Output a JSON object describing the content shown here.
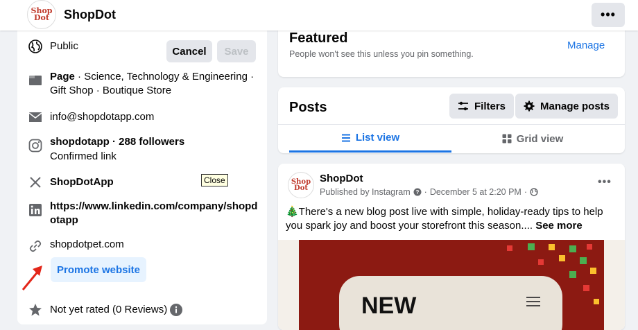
{
  "header": {
    "logo_text": "ShopDot",
    "page_name": "ShopDot",
    "more_label": "•••"
  },
  "intro": {
    "audience": "Public",
    "cancel_label": "Cancel",
    "save_label": "Save",
    "category_prefix": "Page",
    "category_text": " · Science, Technology & Engineering · Gift Shop · Boutique Store",
    "email": "info@shopdotapp.com",
    "instagram": "shopdotapp · 288 followers",
    "instagram_sub": "Confirmed link",
    "x_handle": "ShopDotApp",
    "linkedin": "https://www.linkedin.com/company/shopdotapp",
    "website": "shopdotpet.com",
    "promote_label": "Promote website",
    "rating": "Not yet rated (0 Reviews)",
    "tooltip": "Close"
  },
  "featured": {
    "title": "Featured",
    "subtitle": "People won't see this unless you pin something.",
    "manage_label": "Manage"
  },
  "posts": {
    "title": "Posts",
    "filters_label": "Filters",
    "manage_posts_label": "Manage posts",
    "tabs": [
      {
        "label": "List view",
        "active": true
      },
      {
        "label": "Grid view",
        "active": false
      }
    ]
  },
  "post": {
    "author": "ShopDot",
    "meta": "Published by Instagram",
    "date": "December 5 at 2:20 PM",
    "text": "🎄There's a new blog post live with simple, holiday-ready tips to help you spark joy and boost your storefront this season....",
    "see_more": "See more",
    "image_text": "NEW",
    "more_label": "•••"
  },
  "colors": {
    "accent": "#1b74e4",
    "secondary_text": "#65676b",
    "button_bg": "#e4e6eb",
    "promote_bg": "#e7f3ff"
  }
}
